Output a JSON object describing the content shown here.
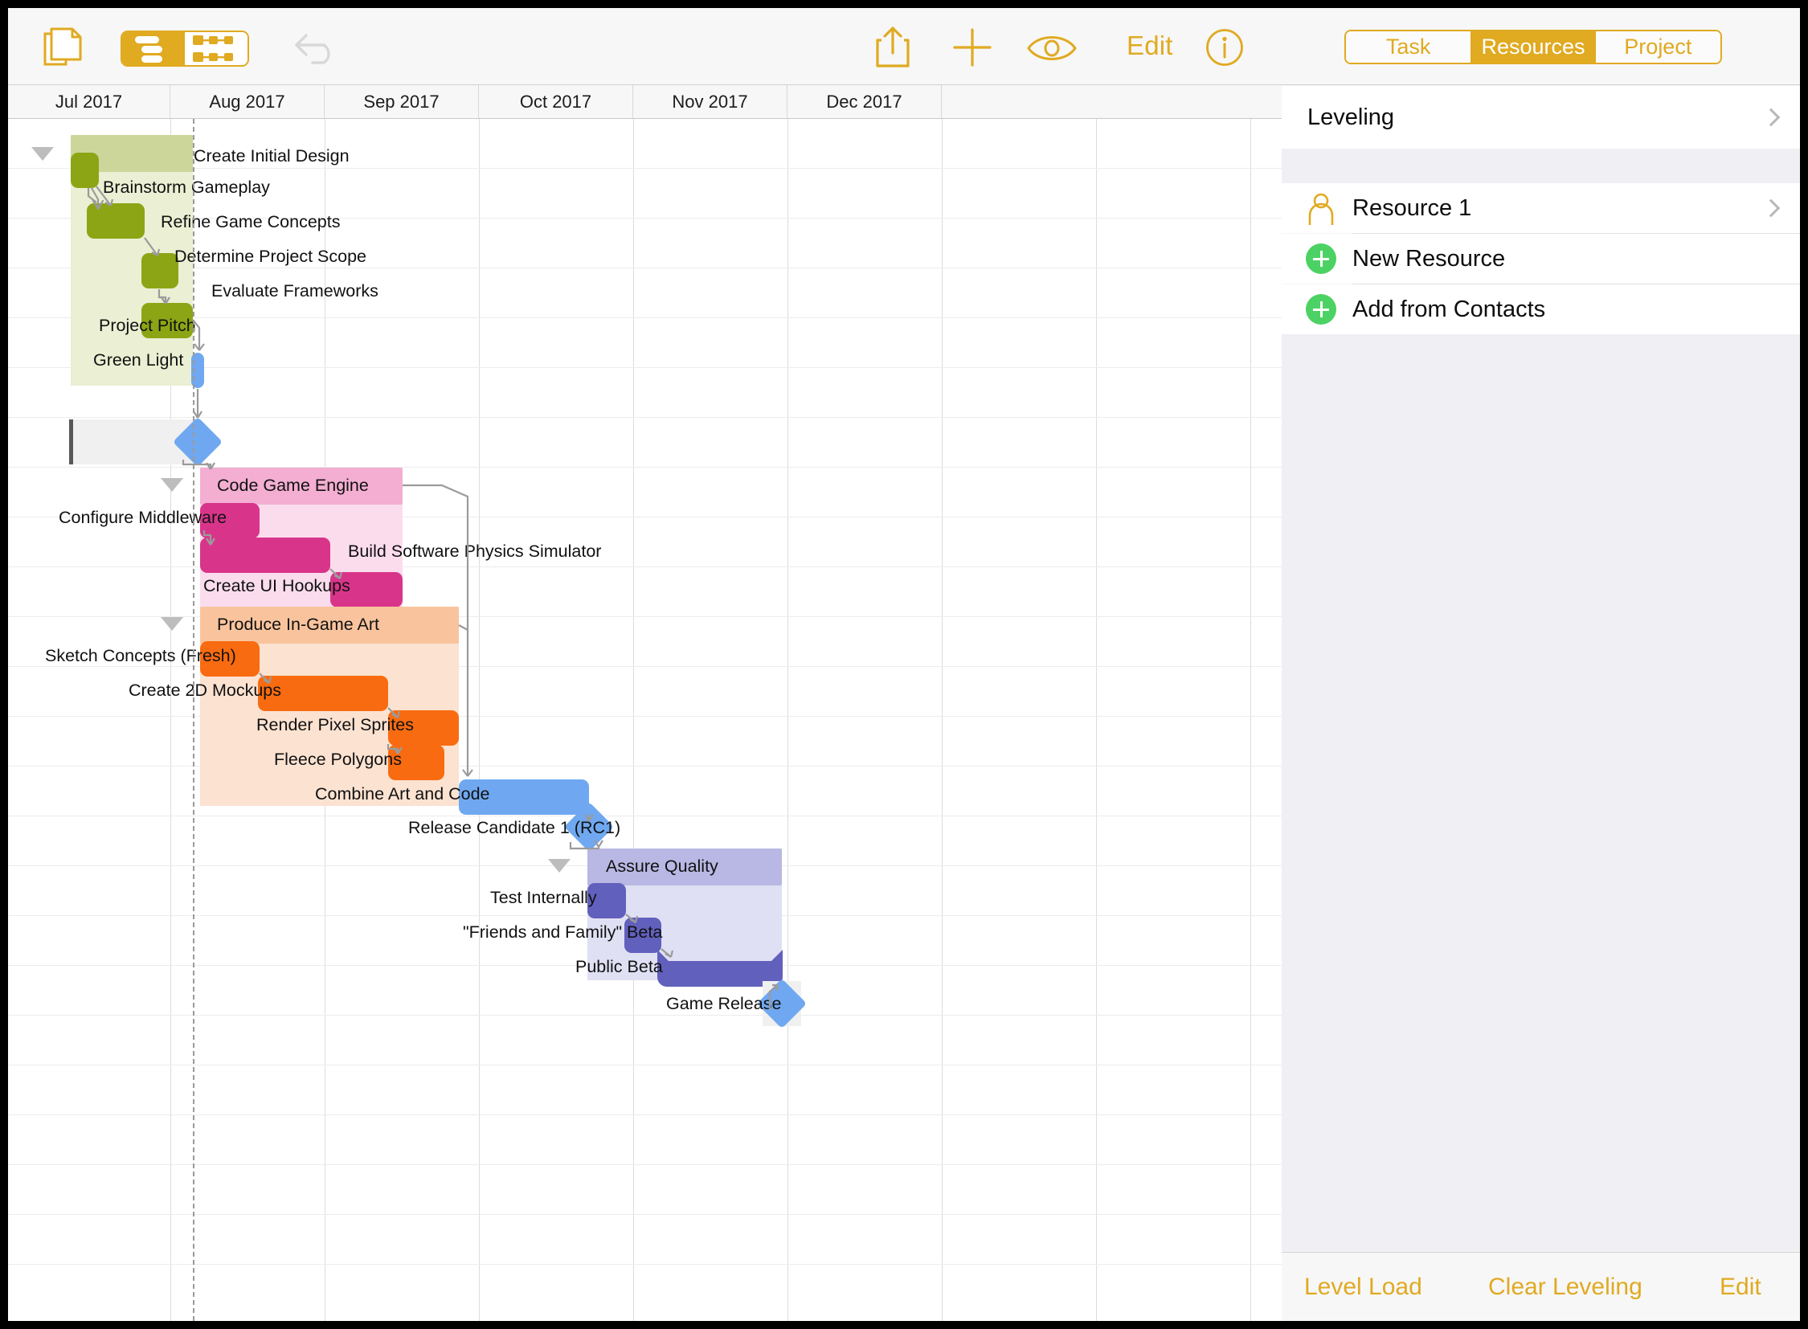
{
  "toolbar": {
    "edit_label": "Edit",
    "icons": {
      "documents": "documents-icon",
      "view_outline": "outline-view-icon",
      "view_network": "network-view-icon",
      "undo": "undo-icon",
      "share": "share-icon",
      "add": "add-icon",
      "view_options": "eye-icon",
      "info": "info-icon"
    },
    "accent_color": "#e0aa21"
  },
  "timeline": {
    "months": [
      "Jul 2017",
      "Aug 2017",
      "Sep 2017",
      "Oct 2017",
      "Nov 2017",
      "Dec 2017"
    ]
  },
  "chart_data": {
    "type": "gantt",
    "title": "",
    "x_axis": {
      "ticks": [
        "Jul 2017",
        "Aug 2017",
        "Sep 2017",
        "Oct 2017",
        "Nov 2017",
        "Dec 2017"
      ]
    },
    "today_marker": "Aug 2017",
    "groups": [
      {
        "name": "Create Initial Design",
        "color": "#8ca514",
        "band_color": "#ebefd3",
        "summary_color": "#ccd69a",
        "tasks": [
          {
            "name": "Brainstorm Gameplay",
            "color": "#8ca514"
          },
          {
            "name": "Refine Game Concepts",
            "color": "#8ca514"
          },
          {
            "name": "Determine Project Scope",
            "color": "#8ca514"
          },
          {
            "name": "Evaluate Frameworks",
            "color": "#8ca514"
          }
        ]
      },
      {
        "name": "Code Game Engine",
        "color": "#d8358a",
        "band_color": "#fbdced",
        "summary_color": "#f3aed2",
        "tasks": [
          {
            "name": "Configure Middleware",
            "color": "#d8358a"
          },
          {
            "name": "Build Software Physics Simulator",
            "color": "#d8358a"
          },
          {
            "name": "Create UI Hookups",
            "color": "#d8358a"
          }
        ]
      },
      {
        "name": "Produce In-Game Art",
        "color": "#f96b10",
        "band_color": "#fce2d1",
        "summary_color": "#f9c49d",
        "tasks": [
          {
            "name": "Sketch Concepts (Fresh)",
            "color": "#f96b10"
          },
          {
            "name": "Create 2D Mockups",
            "color": "#f96b10"
          },
          {
            "name": "Render Pixel Sprites",
            "color": "#f96b10"
          },
          {
            "name": "Fleece Polygons",
            "color": "#f96b10"
          }
        ]
      },
      {
        "name": "Assure Quality",
        "color": "#6260bd",
        "band_color": "#e0e0f4",
        "summary_color": "#b9b7e3",
        "tasks": [
          {
            "name": "Test Internally",
            "color": "#6260bd"
          },
          {
            "name": "\"Friends and Family\" Beta",
            "color": "#6260bd"
          },
          {
            "name": "Public Beta",
            "color": "#6260bd"
          }
        ]
      }
    ],
    "standalone_tasks": [
      {
        "name": "Project Pitch",
        "color": "#6fa8f0",
        "kind": "bar"
      },
      {
        "name": "Green Light",
        "color": "#6fa8f0",
        "kind": "milestone",
        "selected": true
      },
      {
        "name": "Combine Art and Code",
        "color": "#6fa8f0",
        "kind": "bar"
      },
      {
        "name": "Release Candidate 1 (RC1)",
        "color": "#6fa8f0",
        "kind": "milestone"
      },
      {
        "name": "Game Release",
        "color": "#6fa8f0",
        "kind": "milestone",
        "selected": true
      }
    ],
    "row_order": [
      "Create Initial Design",
      "Brainstorm Gameplay",
      "Refine Game Concepts",
      "Determine Project Scope",
      "Evaluate Frameworks",
      "Project Pitch",
      "Green Light",
      "Code Game Engine",
      "Configure Middleware",
      "Build Software Physics Simulator",
      "Create UI Hookups",
      "Produce In-Game Art",
      "Sketch Concepts (Fresh)",
      "Create 2D Mockups",
      "Render Pixel Sprites",
      "Fleece Polygons",
      "Combine Art and Code",
      "Release Candidate 1 (RC1)",
      "Assure Quality",
      "Test Internally",
      "\"Friends and Family\" Beta",
      "Public Beta",
      "Game Release"
    ]
  },
  "inspector": {
    "segments": [
      {
        "label": "Task",
        "active": false
      },
      {
        "label": "Resources",
        "active": true
      },
      {
        "label": "Project",
        "active": false
      }
    ],
    "leveling": {
      "label": "Leveling"
    },
    "resources": [
      {
        "label": "Resource 1",
        "icon": "person-icon",
        "chevron": true
      },
      {
        "label": "New Resource",
        "icon": "plus-circle-icon",
        "chevron": false
      },
      {
        "label": "Add from Contacts",
        "icon": "plus-circle-icon",
        "chevron": false
      }
    ],
    "bottom_bar": {
      "level_load": "Level Load",
      "clear_leveling": "Clear Leveling",
      "edit": "Edit"
    }
  }
}
